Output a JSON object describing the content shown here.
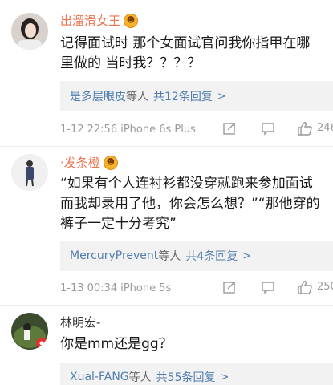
{
  "comments": [
    {
      "name": "出溜滑女王",
      "text": "记得面试时 那个女面试官问我你指甲在哪\n里做的 当时我？？？？",
      "reply_user": "是多层眼皮",
      "reply_mid": "等人",
      "reply_count": "共12条回复",
      "reply_chev": ">",
      "time": "1-12 22:56  iPhone 6s Plus",
      "like_count": "246"
    },
    {
      "name": "·发条橙",
      "text": "“如果有个人连衬衫都没穿就跑来参加面试\n而我却录用了他，你会怎么想？”“那他穿的\n裤子一定十分考究”",
      "reply_user": "MercuryPrevent",
      "reply_mid": "等人",
      "reply_count": "共4条回复",
      "reply_chev": ">",
      "time": "1-13 00:34  iPhone 5s",
      "like_count": "250"
    },
    {
      "name": "林明宏-",
      "text": "你是mm还是gg？",
      "reply_user": "Xual-FANG",
      "reply_mid": "等人",
      "reply_count": "共55条回复",
      "reply_chev": ">"
    }
  ],
  "colors": {
    "accent_name": "#eb7350",
    "link_blue": "#507daf",
    "meta_gray": "#9a9a9a",
    "reply_bg": "#f2f2f2"
  },
  "icons": [
    "vip-badge-icon",
    "share-icon",
    "comment-icon",
    "like-icon"
  ]
}
